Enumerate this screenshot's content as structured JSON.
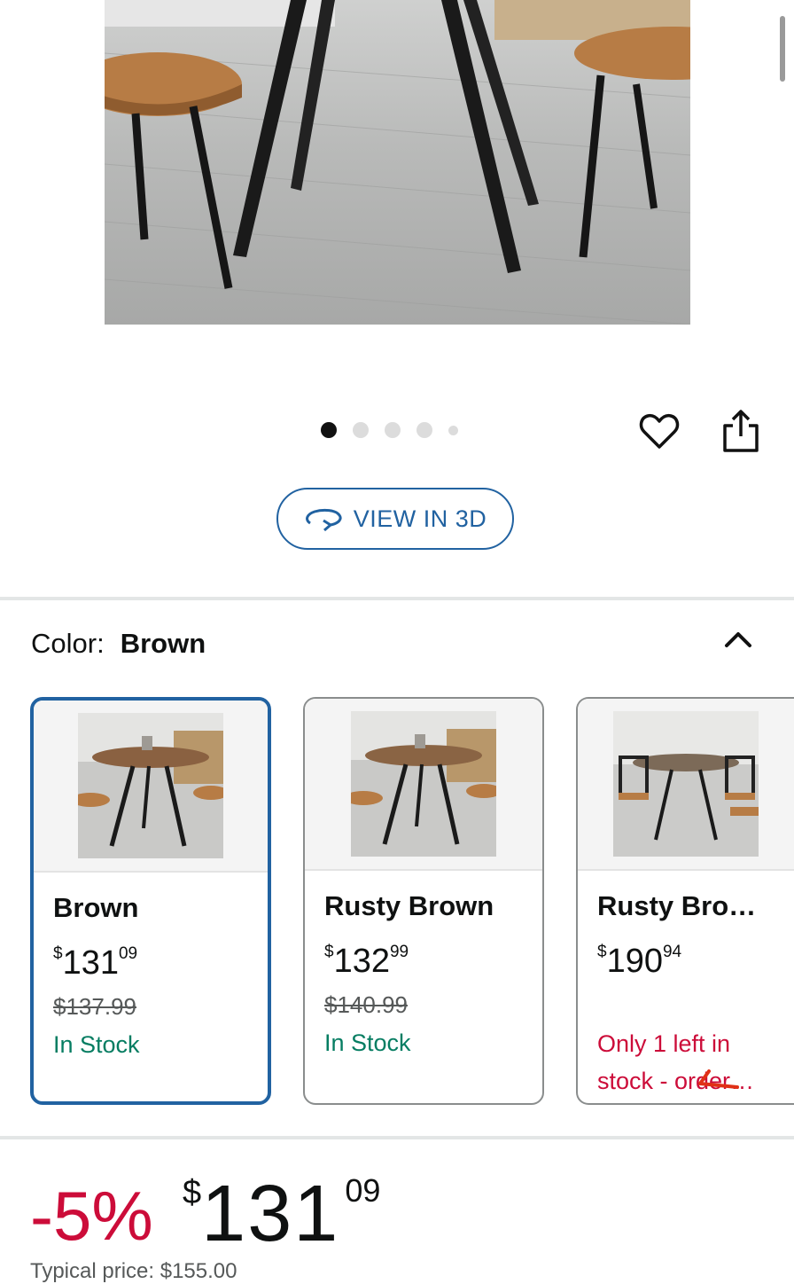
{
  "product": {
    "view3d_label": "VIEW IN 3D",
    "carousel": {
      "count": 5,
      "active": 0
    }
  },
  "color_section": {
    "label": "Color:",
    "selected": "Brown"
  },
  "variants": [
    {
      "name": "Brown",
      "price_currency": "$",
      "price_whole": "131",
      "price_fraction": "09",
      "list_price": "$137.99",
      "stock": "In Stock"
    },
    {
      "name": "Rusty Brown",
      "price_currency": "$",
      "price_whole": "132",
      "price_fraction": "99",
      "list_price": "$140.99",
      "stock": "In Stock"
    },
    {
      "name": "Rusty Brow…",
      "price_currency": "$",
      "price_whole": "190",
      "price_fraction": "94",
      "list_price": "",
      "stock": "Only 1 left in stock - order…"
    }
  ],
  "price_block": {
    "discount": "-5%",
    "currency": "$",
    "whole": "131",
    "fraction": "09",
    "typical_price": "Typical price: $155.00"
  },
  "colors": {
    "accent_blue": "#2162a1",
    "in_stock_green": "#067d62",
    "deal_red": "#cc0c39"
  }
}
